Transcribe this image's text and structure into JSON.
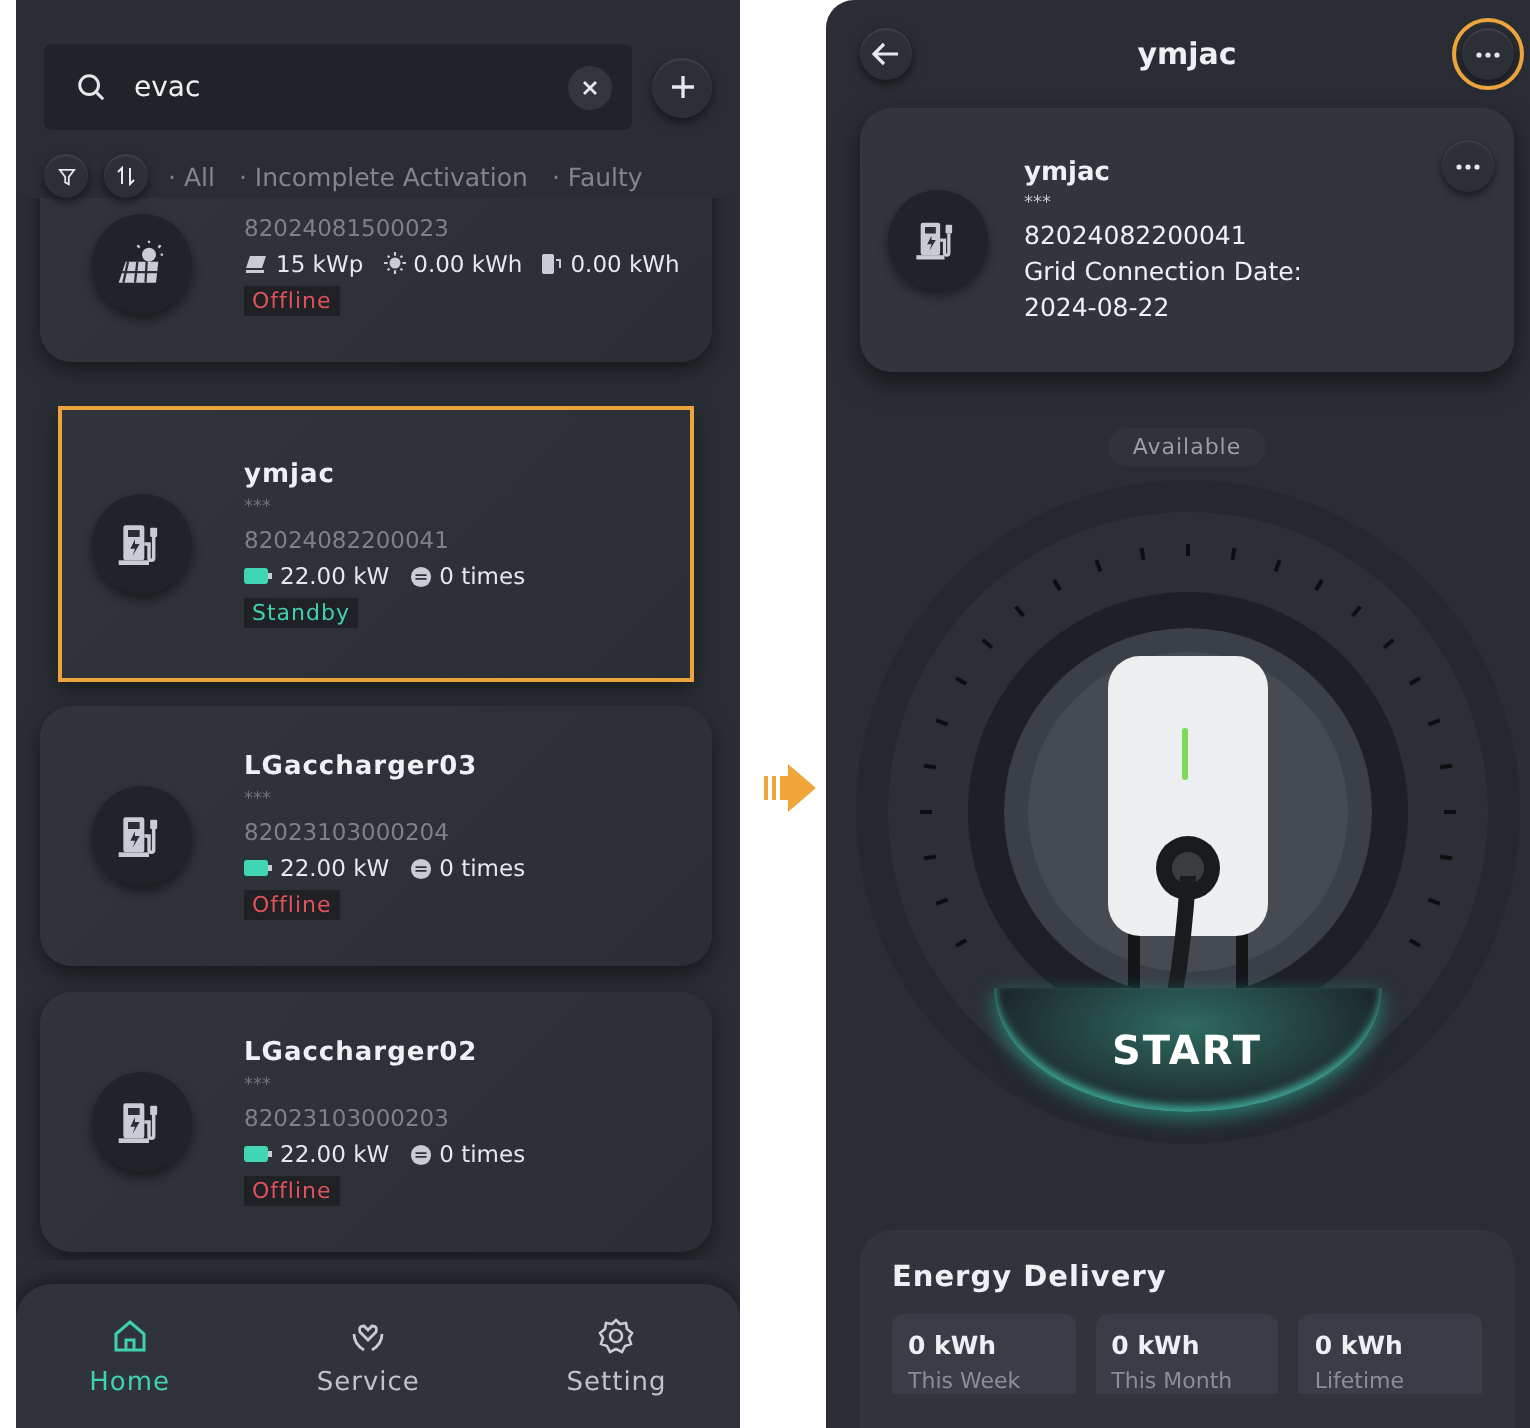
{
  "search": {
    "value": "evac"
  },
  "filters": [
    {
      "label": "· All"
    },
    {
      "label": "· Incomplete Activation"
    },
    {
      "label": "· Faulty"
    }
  ],
  "devices": [
    {
      "kind": "pv",
      "highlighted": false,
      "serial": "82024081500023",
      "metrics": [
        {
          "kind": "panel",
          "text": "15 kWp"
        },
        {
          "kind": "sun",
          "text": "0.00 kWh"
        },
        {
          "kind": "meter",
          "text": "0.00 kWh"
        }
      ],
      "status": {
        "kind": "offline",
        "text": "Offline"
      }
    },
    {
      "kind": "charger",
      "highlighted": true,
      "name": "ymjac",
      "masked": "***",
      "serial": "82024082200041",
      "metrics": [
        {
          "kind": "battery",
          "text": "22.00 kW"
        },
        {
          "kind": "coin",
          "text": "0 times"
        }
      ],
      "status": {
        "kind": "standby",
        "text": "Standby"
      }
    },
    {
      "kind": "charger",
      "highlighted": false,
      "name": "LGaccharger03",
      "masked": "***",
      "serial": "82023103000204",
      "metrics": [
        {
          "kind": "battery",
          "text": "22.00 kW"
        },
        {
          "kind": "coin",
          "text": "0 times"
        }
      ],
      "status": {
        "kind": "offline",
        "text": "Offline"
      }
    },
    {
      "kind": "charger",
      "highlighted": false,
      "name": "LGaccharger02",
      "masked": "***",
      "serial": "82023103000203",
      "metrics": [
        {
          "kind": "battery",
          "text": "22.00 kW"
        },
        {
          "kind": "coin",
          "text": "0 times"
        }
      ],
      "status": {
        "kind": "offline",
        "text": "Offline"
      }
    }
  ],
  "nav": [
    {
      "kind": "home",
      "label": "Home",
      "selected": true
    },
    {
      "kind": "service",
      "label": "Service",
      "selected": false
    },
    {
      "kind": "gear",
      "label": "Setting",
      "selected": false
    }
  ],
  "detail": {
    "title": "ymjac",
    "more_highlighted": true,
    "card": {
      "name": "ymjac",
      "masked": "***",
      "serial": "82024082200041",
      "date_label": "Grid Connection Date:",
      "date": "2024-08-22"
    },
    "state": "Available",
    "start": "START",
    "energy": {
      "title": "Energy Delivery",
      "stats": [
        {
          "value": "0 kWh",
          "label": "This Week"
        },
        {
          "value": "0 kWh",
          "label": "This Month"
        },
        {
          "value": "0 kWh",
          "label": "Lifetime"
        }
      ]
    }
  }
}
